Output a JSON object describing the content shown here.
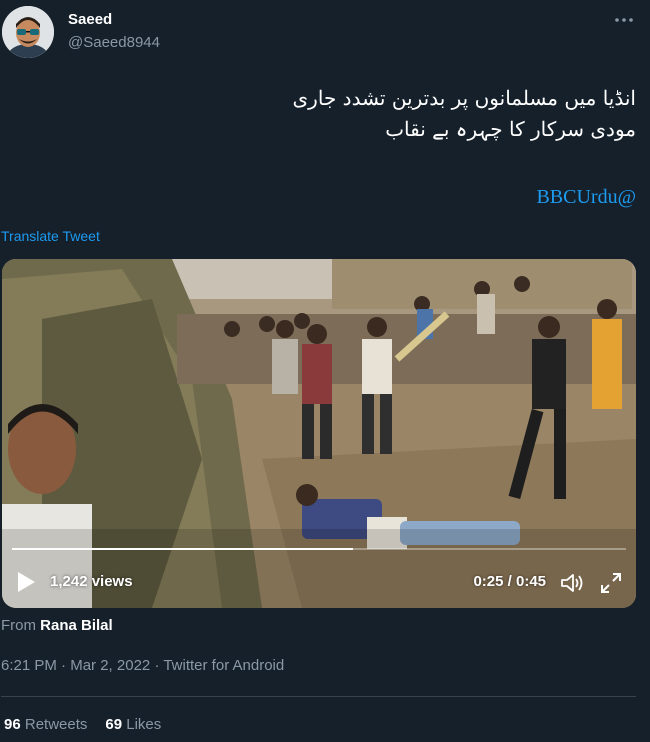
{
  "author": {
    "display_name": "Saeed",
    "handle": "@Saeed8944",
    "avatar_icon": "avatar-photo-sunglasses"
  },
  "more_icon": "more-horizontal-icon",
  "tweet": {
    "text_line_1": "انڈیا میں مسلمانوں پر بدترین تشدد جاری",
    "text_line_2": "مودی سرکار کا چہرہ بے نقاب",
    "mention": "BBCUrdu@",
    "translate_label": "Translate Tweet"
  },
  "video": {
    "views": "1,242 views",
    "time": "0:25 / 0:45",
    "progress_fraction": 0.556,
    "play_icon": "play-icon",
    "volume_icon": "volume-icon",
    "fullscreen_icon": "fullscreen-icon"
  },
  "source": {
    "prefix": "From",
    "name": "Rana Bilal"
  },
  "meta": {
    "time": "6:21 PM",
    "date": "Mar 2, 2022",
    "client": "Twitter for Android",
    "separator": "·"
  },
  "stats": {
    "retweets_count": "96",
    "retweets_label": "Retweets",
    "likes_count": "69",
    "likes_label": "Likes"
  },
  "colors": {
    "background": "#15202b",
    "accent": "#1d9bf0",
    "secondary_text": "#8b98a5",
    "divider": "#38444d"
  }
}
